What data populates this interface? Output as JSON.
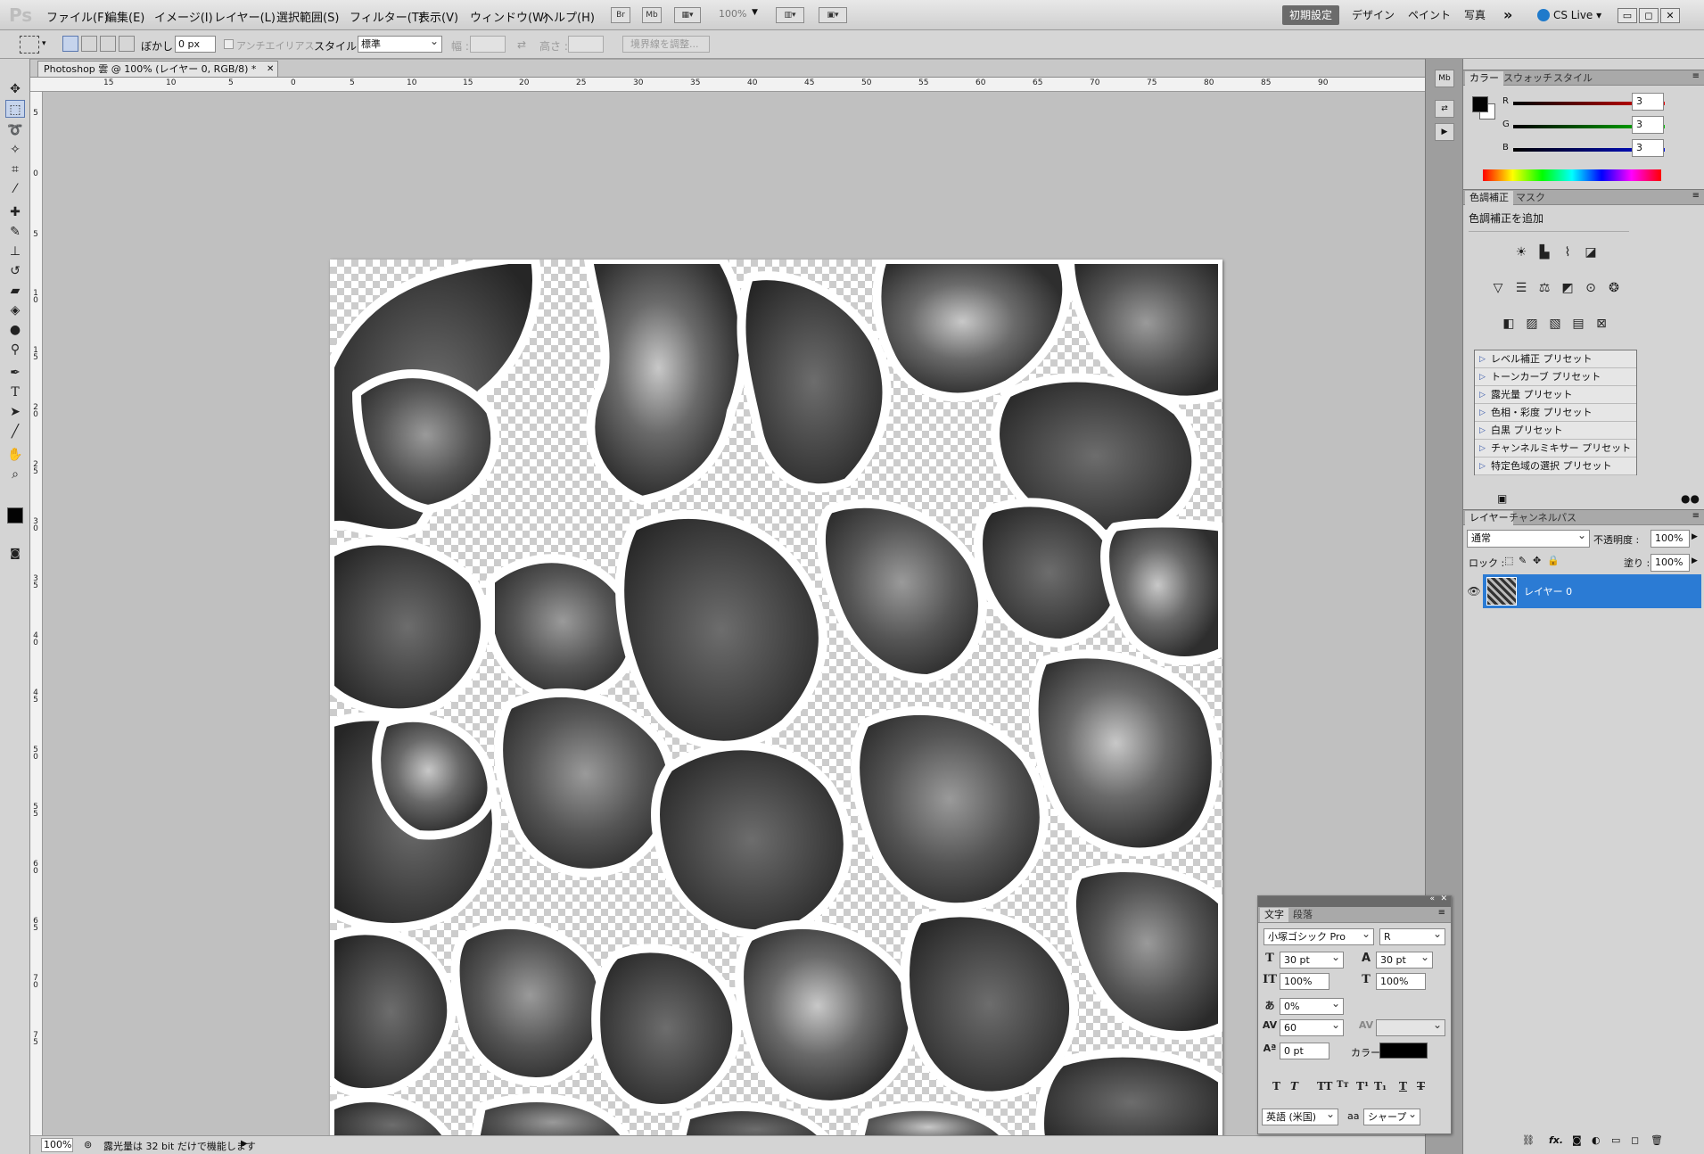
{
  "app": {
    "logo": "Ps",
    "menus": [
      "ファイル(F)",
      "編集(E)",
      "イメージ(I)",
      "レイヤー(L)",
      "選択範囲(S)",
      "フィルター(T)",
      "表示(V)",
      "ウィンドウ(W)",
      "ヘルプ(H)"
    ],
    "bridge_label": "Br",
    "mini_bridge_label": "Mb",
    "zoom_display": "100%",
    "workspaces": [
      "初期設定",
      "デザイン",
      "ペイント",
      "写真"
    ],
    "more_label": "»",
    "cslive_label": "CS Live"
  },
  "options": {
    "feather_label": "ぼかし :",
    "feather_value": "0 px",
    "antialias_label": "アンチエイリアス",
    "style_label": "スタイル :",
    "style_value": "標準",
    "width_label": "幅 :",
    "height_label": "高さ :",
    "refine_edge_label": "境界線を調整..."
  },
  "document": {
    "tab_title": "Photoshop 雲 @ 100% (レイヤー 0, RGB/8) *",
    "ruler_top": [
      "15",
      "10",
      "5",
      "0",
      "5",
      "10",
      "15",
      "20",
      "25",
      "30",
      "35",
      "40",
      "45",
      "50",
      "55",
      "60",
      "65",
      "70",
      "75",
      "80",
      "85",
      "90"
    ],
    "ruler_left": [
      "5",
      "0",
      "5",
      "1 0",
      "1 5",
      "2 0",
      "2 5",
      "3 0",
      "3 5",
      "4 0",
      "4 5",
      "5 0",
      "5 5",
      "6 0",
      "6 5",
      "7 0",
      "7 5"
    ]
  },
  "status": {
    "zoom": "100%",
    "message": "露光量は 32 bit だけで機能します"
  },
  "color_panel": {
    "tabs": [
      "カラー",
      "スウォッチ",
      "スタイル"
    ],
    "r_label": "R",
    "g_label": "G",
    "b_label": "B",
    "r_value": "3",
    "g_value": "3",
    "b_value": "3",
    "foreground": "#030303",
    "background": "#ffffff"
  },
  "adjustments_panel": {
    "tabs": [
      "色調補正",
      "マスク"
    ],
    "title": "色調補正を追加",
    "presets": [
      "レベル補正 プリセット",
      "トーンカーブ プリセット",
      "露光量 プリセット",
      "色相・彩度 プリセット",
      "白黒 プリセット",
      "チャンネルミキサー プリセット",
      "特定色域の選択 プリセット"
    ]
  },
  "layers_panel": {
    "tabs": [
      "レイヤー",
      "チャンネル",
      "パス"
    ],
    "blend_mode": "通常",
    "opacity_label": "不透明度 :",
    "opacity_value": "100%",
    "lock_label": "ロック :",
    "fill_label": "塗り :",
    "fill_value": "100%",
    "layer_name": "レイヤー 0"
  },
  "character_panel": {
    "tabs": [
      "文字",
      "段落"
    ],
    "font_family": "小塚ゴシック Pro",
    "font_style": "R",
    "font_size": "30 pt",
    "leading": "30 pt",
    "vertical_scale": "100%",
    "horizontal_scale": "100%",
    "tsume": "0%",
    "tracking": "60",
    "baseline_shift": "0 pt",
    "color_label": "カラー :",
    "color_value": "#000000",
    "language": "英語 (米国)",
    "antialias_prefix": "aa",
    "antialias": "シャープ"
  }
}
